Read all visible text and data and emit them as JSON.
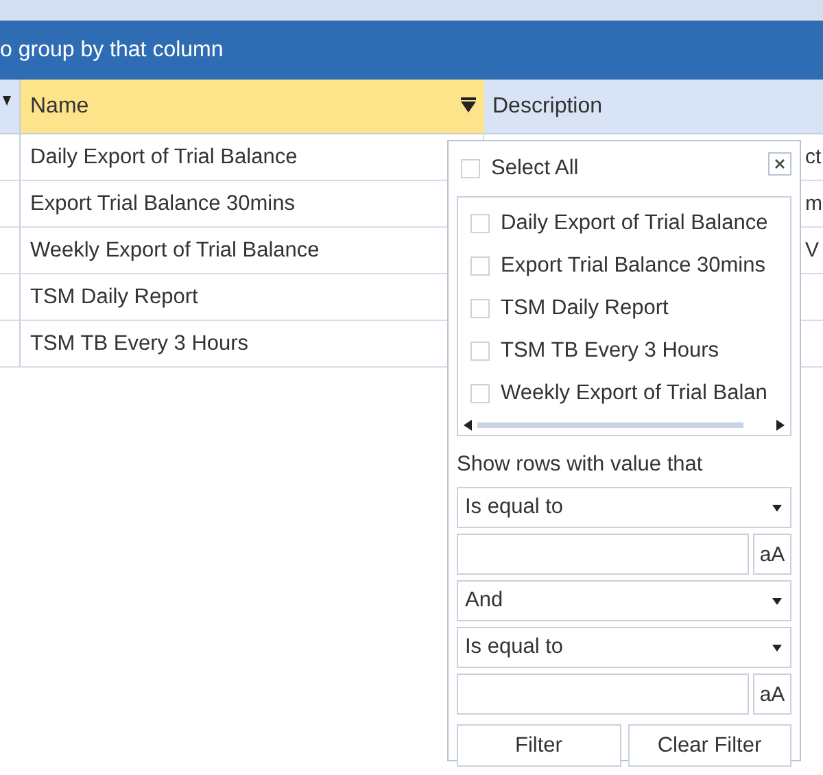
{
  "group_panel": {
    "text": "o group by that column"
  },
  "columns": [
    {
      "label": "Name",
      "selected": true
    },
    {
      "label": "Description",
      "selected": false
    }
  ],
  "rows": [
    {
      "name": "Daily Export of Trial Balance",
      "description": "ct"
    },
    {
      "name": "Export Trial Balance 30mins",
      "description": "m"
    },
    {
      "name": "Weekly Export of Trial Balance",
      "description": "V"
    },
    {
      "name": "TSM Daily Report"
    },
    {
      "name": "TSM TB Every 3 Hours"
    }
  ],
  "filter_popup": {
    "select_all": {
      "label": "Select All",
      "checked": false
    },
    "values": [
      {
        "label": "Daily Export of Trial Balance",
        "checked": false
      },
      {
        "label": "Export Trial Balance 30mins",
        "checked": false
      },
      {
        "label": "TSM Daily Report",
        "checked": false
      },
      {
        "label": "TSM TB Every 3 Hours",
        "checked": false
      },
      {
        "label": "Weekly Export of Trial Balan",
        "checked": false
      }
    ],
    "prompt": "Show rows with value that",
    "operator_1": "Is equal to",
    "case_button_1": "aA",
    "logic": "And",
    "operator_2": "Is equal to",
    "case_button_2": "aA",
    "buttons": [
      "Filter",
      "Clear Filter"
    ]
  }
}
